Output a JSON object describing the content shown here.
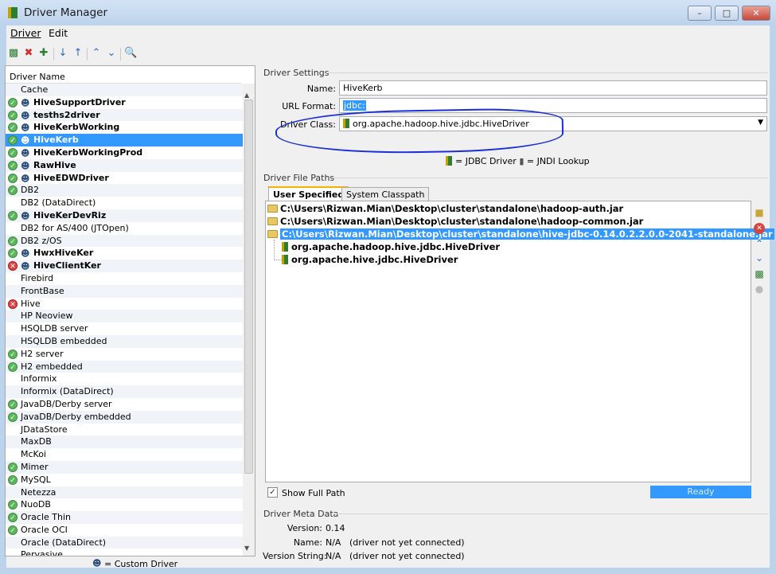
{
  "window": {
    "title": "Driver Manager",
    "controls": [
      "minimize",
      "maximize",
      "close"
    ]
  },
  "menu": [
    "Driver",
    "Edit"
  ],
  "toolbar": [
    "new-driver",
    "delete-driver",
    "copy-driver",
    "sort-ascending",
    "sort-descending",
    "move-up",
    "move-down",
    "find-driver"
  ],
  "list": {
    "header": "Driver Name",
    "legend": "= Custom Driver",
    "items": [
      {
        "label": "Cache",
        "status": "none"
      },
      {
        "label": "HiveSupportDriver",
        "status": "ok",
        "custom": true
      },
      {
        "label": "tesths2driver",
        "status": "ok",
        "custom": true
      },
      {
        "label": "HiveKerbWorking",
        "status": "ok",
        "custom": true
      },
      {
        "label": "HiveKerb",
        "status": "ok",
        "custom": true,
        "selected": true
      },
      {
        "label": "HiveKerbWorkingProd",
        "status": "ok",
        "custom": true
      },
      {
        "label": "RawHive",
        "status": "ok",
        "custom": true
      },
      {
        "label": "HiveEDWDriver",
        "status": "ok",
        "custom": true
      },
      {
        "label": "DB2",
        "status": "ok"
      },
      {
        "label": "DB2 (DataDirect)",
        "status": "none"
      },
      {
        "label": "HiveKerDevRiz",
        "status": "ok",
        "custom": true
      },
      {
        "label": "DB2 for AS/400 (JTOpen)",
        "status": "none"
      },
      {
        "label": "DB2 z/OS",
        "status": "ok"
      },
      {
        "label": "HwxHiveKer",
        "status": "ok",
        "custom": true
      },
      {
        "label": "HiveClientKer",
        "status": "error",
        "custom": true
      },
      {
        "label": "Firebird",
        "status": "none"
      },
      {
        "label": "FrontBase",
        "status": "none"
      },
      {
        "label": "Hive",
        "status": "error"
      },
      {
        "label": "HP Neoview",
        "status": "none"
      },
      {
        "label": "HSQLDB server",
        "status": "none"
      },
      {
        "label": "HSQLDB embedded",
        "status": "none"
      },
      {
        "label": "H2 server",
        "status": "ok"
      },
      {
        "label": "H2 embedded",
        "status": "ok"
      },
      {
        "label": "Informix",
        "status": "none"
      },
      {
        "label": "Informix (DataDirect)",
        "status": "none"
      },
      {
        "label": "JavaDB/Derby server",
        "status": "ok"
      },
      {
        "label": "JavaDB/Derby embedded",
        "status": "ok"
      },
      {
        "label": "JDataStore",
        "status": "none"
      },
      {
        "label": "MaxDB",
        "status": "none"
      },
      {
        "label": "McKoi",
        "status": "none"
      },
      {
        "label": "Mimer",
        "status": "ok"
      },
      {
        "label": "MySQL",
        "status": "ok"
      },
      {
        "label": "Netezza",
        "status": "none"
      },
      {
        "label": "NuoDB",
        "status": "ok"
      },
      {
        "label": "Oracle Thin",
        "status": "ok"
      },
      {
        "label": "Oracle OCI",
        "status": "ok"
      },
      {
        "label": "Oracle (DataDirect)",
        "status": "none"
      },
      {
        "label": "Pervasive",
        "status": "none"
      }
    ]
  },
  "settings": {
    "section": "Driver Settings",
    "name_label": "Name:",
    "name_value": "HiveKerb",
    "url_label": "URL Format:",
    "url_value": "jdbc:",
    "class_label": "Driver Class:",
    "class_value": "org.apache.hadoop.hive.jdbc.HiveDriver",
    "legend_jdbc": "= JDBC Driver",
    "legend_jndi": "= JNDI Lookup"
  },
  "paths": {
    "section": "Driver File Paths",
    "tabs": [
      "User Specified",
      "System Classpath"
    ],
    "entries": [
      "C:\\Users\\Rizwan.Mian\\Desktop\\cluster\\standalone\\hadoop-auth.jar",
      "C:\\Users\\Rizwan.Mian\\Desktop\\cluster\\standalone\\hadoop-common.jar",
      "C:\\Users\\Rizwan.Mian\\Desktop\\cluster\\standalone\\hive-jdbc-0.14.0.2.2.0.0-2041-standalone.jar"
    ],
    "classes": [
      "org.apache.hadoop.hive.jdbc.HiveDriver",
      "org.apache.hive.jdbc.HiveDriver"
    ],
    "show_full_path": "Show Full Path",
    "status": "Ready"
  },
  "meta": {
    "section": "Driver Meta Data",
    "version_label": "Version:",
    "version": "0.14",
    "name_label": "Name:",
    "name": "N/A   (driver not yet connected)",
    "vs_label": "Version String:",
    "vs": "N/A   (driver not yet connected)"
  }
}
